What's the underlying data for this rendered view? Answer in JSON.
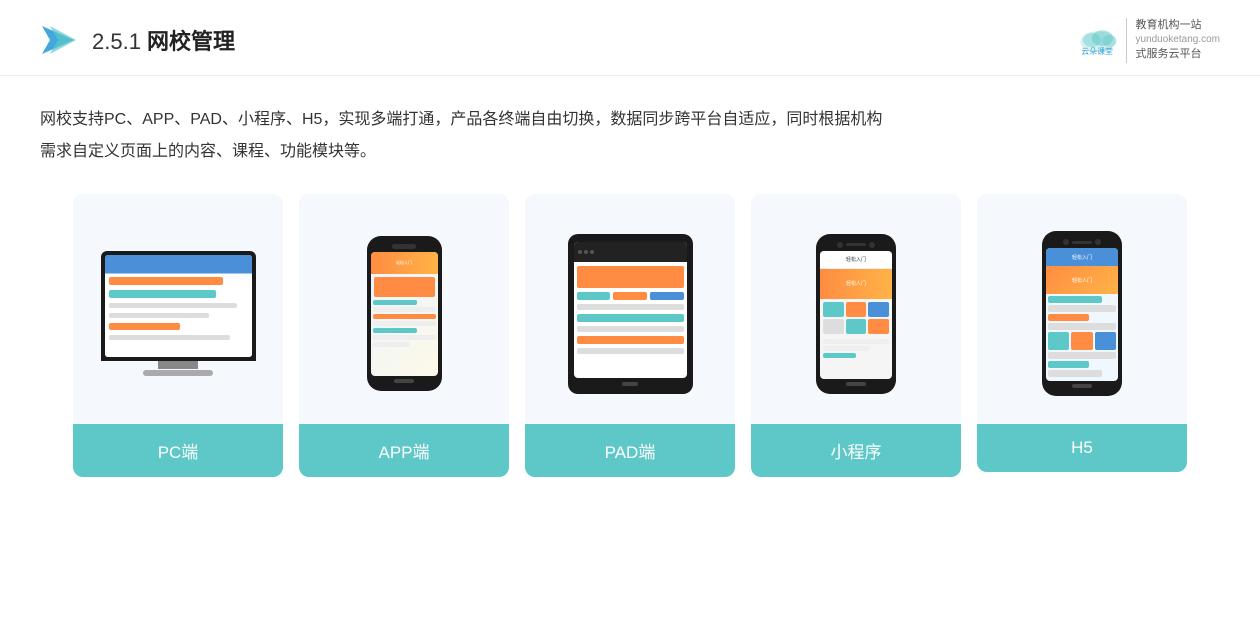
{
  "header": {
    "section": "2.5.1",
    "title_normal": "2.5.1 ",
    "title_bold": "网校管理",
    "brand_site": "yunduoketang.com",
    "brand_tagline1": "教育机构一站",
    "brand_tagline2": "式服务云平台"
  },
  "description": {
    "line1": "网校支持PC、APP、PAD、小程序、H5，实现多端打通，产品各终端自由切换，数据同步跨平台自适应，同时根据机构",
    "line2": "需求自定义页面上的内容、课程、功能模块等。"
  },
  "cards": [
    {
      "id": "pc",
      "label": "PC端"
    },
    {
      "id": "app",
      "label": "APP端"
    },
    {
      "id": "pad",
      "label": "PAD端"
    },
    {
      "id": "miniapp",
      "label": "小程序"
    },
    {
      "id": "h5",
      "label": "H5"
    }
  ],
  "colors": {
    "teal": "#5ec8c8",
    "orange": "#ff8c42",
    "blue": "#4a90d9",
    "dark": "#1a1a1a",
    "card_bg": "#f0f5fb"
  }
}
